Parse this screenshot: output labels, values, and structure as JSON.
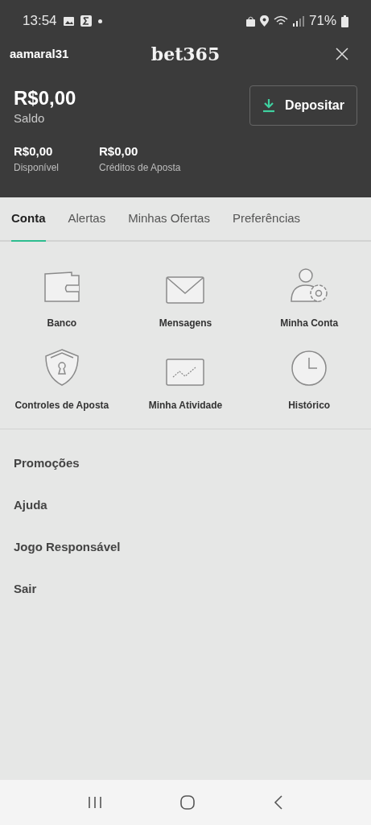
{
  "status_bar": {
    "time": "13:54",
    "battery": "71%"
  },
  "header": {
    "username": "aamaral31",
    "logo": "bet365"
  },
  "balance": {
    "amount": "R$0,00",
    "label": "Saldo",
    "deposit_button": "Depositar",
    "details": [
      {
        "amount": "R$0,00",
        "label": "Disponível"
      },
      {
        "amount": "R$0,00",
        "label": "Créditos de Aposta"
      }
    ]
  },
  "tabs": [
    {
      "label": "Conta",
      "selected": true
    },
    {
      "label": "Alertas",
      "selected": false
    },
    {
      "label": "Minhas Ofertas",
      "selected": false
    },
    {
      "label": "Preferências",
      "selected": false
    }
  ],
  "tiles": [
    {
      "kind": "wallet",
      "label": "Banco"
    },
    {
      "kind": "envelope",
      "label": "Mensagens"
    },
    {
      "kind": "user-gear",
      "label": "Minha Conta"
    },
    {
      "kind": "shield",
      "label": "Controles de Aposta"
    },
    {
      "kind": "chart",
      "label": "Minha Atividade"
    },
    {
      "kind": "clock",
      "label": "Histórico"
    }
  ],
  "links": [
    "Promoções",
    "Ajuda",
    "Jogo Responsável",
    "Sair"
  ]
}
